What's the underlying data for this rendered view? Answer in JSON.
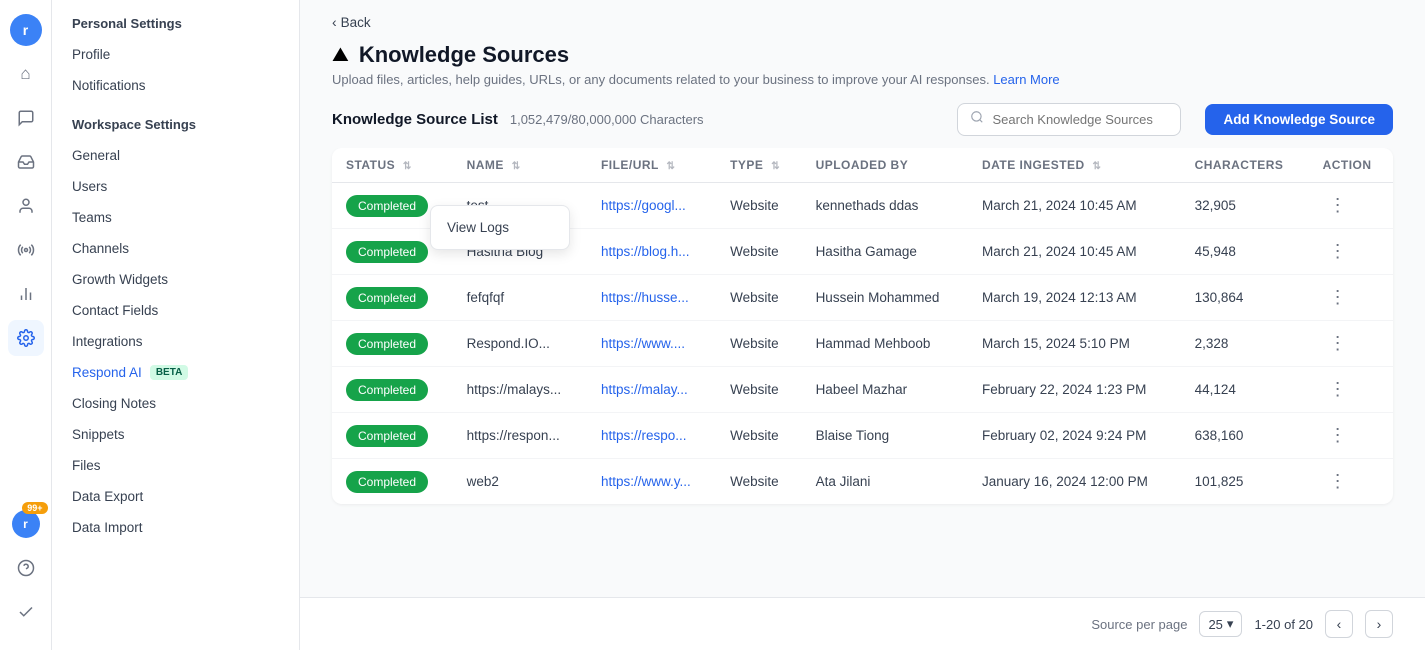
{
  "leftbar": {
    "avatar": "r",
    "icons": [
      {
        "name": "home-icon",
        "symbol": "⌂",
        "active": false
      },
      {
        "name": "chat-icon",
        "symbol": "💬",
        "active": false
      },
      {
        "name": "inbox-icon",
        "symbol": "📥",
        "active": false
      },
      {
        "name": "contacts-icon",
        "symbol": "👤",
        "active": false
      },
      {
        "name": "broadcast-icon",
        "symbol": "📡",
        "active": false
      },
      {
        "name": "reports-icon",
        "symbol": "📊",
        "active": false
      },
      {
        "name": "settings-icon",
        "symbol": "⚙",
        "active": true
      }
    ],
    "bottom_icons": [
      {
        "name": "user-icon",
        "symbol": "👤",
        "active": false,
        "badge": "99+"
      },
      {
        "name": "help-icon",
        "symbol": "❓",
        "active": false
      },
      {
        "name": "check-icon",
        "symbol": "✓",
        "active": false
      }
    ]
  },
  "sidebar": {
    "personal_title": "Personal Settings",
    "personal_items": [
      {
        "label": "Profile",
        "active": false
      },
      {
        "label": "Notifications",
        "active": false
      }
    ],
    "workspace_title": "Workspace Settings",
    "workspace_items": [
      {
        "label": "General",
        "active": false
      },
      {
        "label": "Users",
        "active": false
      },
      {
        "label": "Teams",
        "active": false
      },
      {
        "label": "Channels",
        "active": false
      },
      {
        "label": "Growth Widgets",
        "active": false
      },
      {
        "label": "Contact Fields",
        "active": false
      },
      {
        "label": "Integrations",
        "active": false
      },
      {
        "label": "Respond AI",
        "beta": true,
        "active": true
      },
      {
        "label": "Closing Notes",
        "active": false
      },
      {
        "label": "Snippets",
        "active": false
      },
      {
        "label": "Files",
        "active": false
      },
      {
        "label": "Data Export",
        "active": false
      },
      {
        "label": "Data Import",
        "active": false
      }
    ]
  },
  "nav": {
    "back_label": "Back"
  },
  "header": {
    "title": "Knowledge Sources",
    "subtitle": "Upload files, articles, help guides, URLs, or any documents related to your business to improve your AI responses.",
    "learn_more": "Learn More"
  },
  "list": {
    "title": "Knowledge Source List",
    "char_count": "1,052,479/80,000,000 Characters",
    "search_placeholder": "Search Knowledge Sources",
    "add_button": "Add Knowledge Source"
  },
  "table": {
    "columns": [
      {
        "key": "status",
        "label": "STATUS"
      },
      {
        "key": "name",
        "label": "NAME"
      },
      {
        "key": "file_url",
        "label": "FILE/URL"
      },
      {
        "key": "type",
        "label": "TYPE"
      },
      {
        "key": "uploaded_by",
        "label": "UPLOADED BY"
      },
      {
        "key": "date_ingested",
        "label": "DATE INGESTED"
      },
      {
        "key": "characters",
        "label": "CHARACTERS"
      },
      {
        "key": "action",
        "label": "ACTION"
      }
    ],
    "rows": [
      {
        "status": "Completed",
        "name": "test",
        "file_url": "https://googl...",
        "file_url_full": "https://googl...",
        "type": "Website",
        "uploaded_by": "kennethads ddas",
        "date_ingested": "March 21, 2024 10:45 AM",
        "characters": "32,905"
      },
      {
        "status": "Completed",
        "name": "Hasitha Blog",
        "file_url": "https://blog.h...",
        "file_url_full": "https://blog.h...",
        "type": "Website",
        "uploaded_by": "Hasitha Gamage",
        "date_ingested": "March 21, 2024 10:45 AM",
        "characters": "45,948"
      },
      {
        "status": "Completed",
        "name": "fefqfqf",
        "file_url": "https://husse...",
        "file_url_full": "https://husse...",
        "type": "Website",
        "uploaded_by": "Hussein Mohammed",
        "date_ingested": "March 19, 2024 12:13 AM",
        "characters": "130,864"
      },
      {
        "status": "Completed",
        "name": "Respond.IO...",
        "file_url": "https://www....",
        "file_url_full": "https://www....",
        "type": "Website",
        "uploaded_by": "Hammad Mehboob",
        "date_ingested": "March 15, 2024 5:10 PM",
        "characters": "2,328"
      },
      {
        "status": "Completed",
        "name": "https://malays...",
        "file_url": "https://malay...",
        "file_url_full": "https://malay...",
        "type": "Website",
        "uploaded_by": "Habeel Mazhar",
        "date_ingested": "February 22, 2024 1:23 PM",
        "characters": "44,124"
      },
      {
        "status": "Completed",
        "name": "https://respon...",
        "file_url": "https://respo...",
        "file_url_full": "https://respo...",
        "type": "Website",
        "uploaded_by": "Blaise Tiong",
        "date_ingested": "February 02, 2024 9:24 PM",
        "characters": "638,160"
      },
      {
        "status": "Completed",
        "name": "web2",
        "file_url": "https://www.y...",
        "file_url_full": "https://www.y...",
        "type": "Website",
        "uploaded_by": "Ata Jilani",
        "date_ingested": "January 16, 2024 12:00 PM",
        "characters": "101,825"
      }
    ]
  },
  "pagination": {
    "source_per_page_label": "Source per page",
    "per_page": "25",
    "page_range": "1-20 of 20"
  },
  "dropdown": {
    "view_logs": "View Logs"
  }
}
